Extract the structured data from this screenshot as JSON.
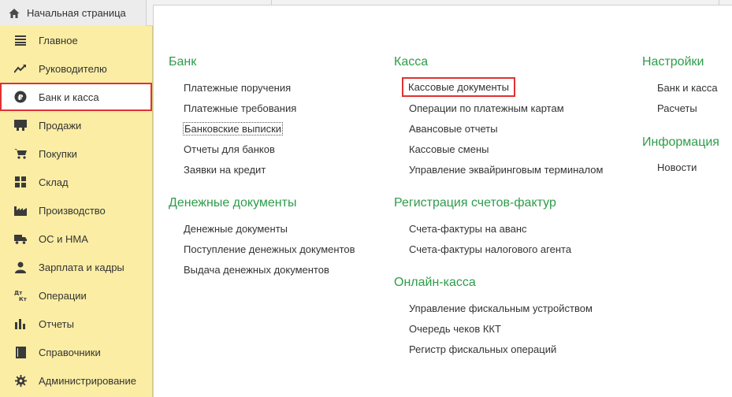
{
  "topbar": {
    "home_tab_label": "Начальная страница"
  },
  "sidebar": {
    "items": [
      {
        "label": "Главное",
        "icon": "list-icon"
      },
      {
        "label": "Руководителю",
        "icon": "trend-icon"
      },
      {
        "label": "Банк и касса",
        "icon": "ruble-icon"
      },
      {
        "label": "Продажи",
        "icon": "cart-sell-icon"
      },
      {
        "label": "Покупки",
        "icon": "cart-icon"
      },
      {
        "label": "Склад",
        "icon": "grid-icon"
      },
      {
        "label": "Производство",
        "icon": "factory-icon"
      },
      {
        "label": "ОС и НМА",
        "icon": "truck-icon"
      },
      {
        "label": "Зарплата и кадры",
        "icon": "person-icon"
      },
      {
        "label": "Операции",
        "icon": "dt-kt-icon"
      },
      {
        "label": "Отчеты",
        "icon": "bar-chart-icon"
      },
      {
        "label": "Справочники",
        "icon": "book-icon"
      },
      {
        "label": "Администрирование",
        "icon": "gear-icon"
      }
    ]
  },
  "colors": {
    "section_title": "#2e9c4a",
    "sidebar_bg": "#fbeda4",
    "highlight_border": "#e03131"
  },
  "main": {
    "bank": {
      "title": "Банк",
      "links": [
        "Платежные поручения",
        "Платежные требования",
        "Банковские выписки",
        "Отчеты для банков",
        "Заявки на кредит"
      ]
    },
    "money_docs": {
      "title": "Денежные документы",
      "links": [
        "Денежные документы",
        "Поступление денежных документов",
        "Выдача денежных документов"
      ]
    },
    "cash": {
      "title": "Касса",
      "links": [
        "Кассовые документы",
        "Операции по платежным картам",
        "Авансовые отчеты",
        "Кассовые смены",
        "Управление эквайринговым терминалом"
      ]
    },
    "invoices": {
      "title": "Регистрация счетов-фактур",
      "links": [
        "Счета-фактуры на аванс",
        "Счета-фактуры налогового агента"
      ]
    },
    "online_cash": {
      "title": "Онлайн-касса",
      "links": [
        "Управление фискальным устройством",
        "Очередь чеков ККТ",
        "Регистр фискальных операций"
      ]
    },
    "settings": {
      "title": "Настройки",
      "links": [
        "Банк и касса",
        "Расчеты"
      ]
    },
    "info": {
      "title": "Информация",
      "links": [
        "Новости"
      ]
    }
  }
}
